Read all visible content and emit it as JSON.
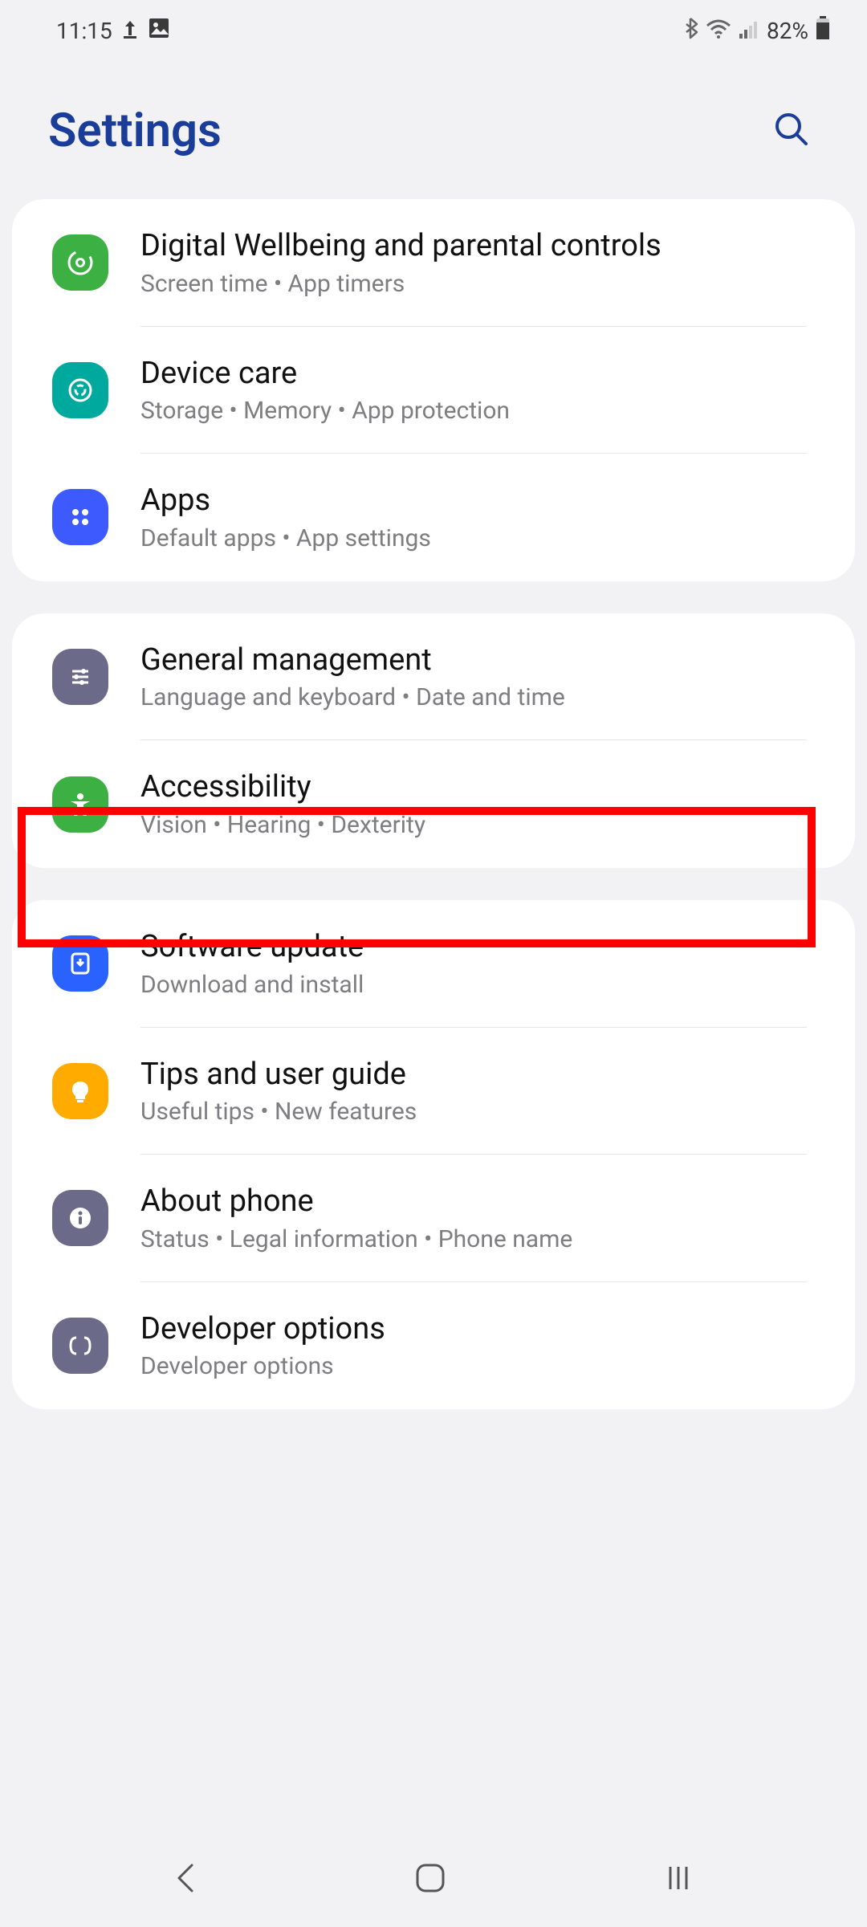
{
  "status": {
    "time": "11:15",
    "battery": "82%"
  },
  "header": {
    "title": "Settings"
  },
  "groups": [
    {
      "rows": [
        {
          "icon": "wellbeing-icon",
          "iconClass": "bg-green1",
          "title": "Digital Wellbeing and parental controls",
          "subtitle": "Screen time  •  App timers"
        },
        {
          "icon": "device-care-icon",
          "iconClass": "bg-teal",
          "title": "Device care",
          "subtitle": "Storage  •  Memory  •  App protection"
        },
        {
          "icon": "apps-icon",
          "iconClass": "bg-blue1",
          "title": "Apps",
          "subtitle": "Default apps  •  App settings"
        }
      ]
    },
    {
      "rows": [
        {
          "icon": "sliders-icon",
          "iconClass": "bg-slate",
          "title": "General management",
          "subtitle": "Language and keyboard  •  Date and time"
        },
        {
          "icon": "accessibility-icon",
          "iconClass": "bg-green2",
          "title": "Accessibility",
          "subtitle": "Vision  •  Hearing  •  Dexterity"
        }
      ]
    },
    {
      "rows": [
        {
          "icon": "update-icon",
          "iconClass": "bg-blue2",
          "title": "Software update",
          "subtitle": "Download and install"
        },
        {
          "icon": "tips-icon",
          "iconClass": "bg-orange",
          "title": "Tips and user guide",
          "subtitle": "Useful tips  •  New features"
        },
        {
          "icon": "about-icon",
          "iconClass": "bg-slate2",
          "title": "About phone",
          "subtitle": "Status  •  Legal information  •  Phone name"
        },
        {
          "icon": "developer-icon",
          "iconClass": "bg-slate3",
          "title": "Developer options",
          "subtitle": "Developer options"
        }
      ]
    }
  ]
}
